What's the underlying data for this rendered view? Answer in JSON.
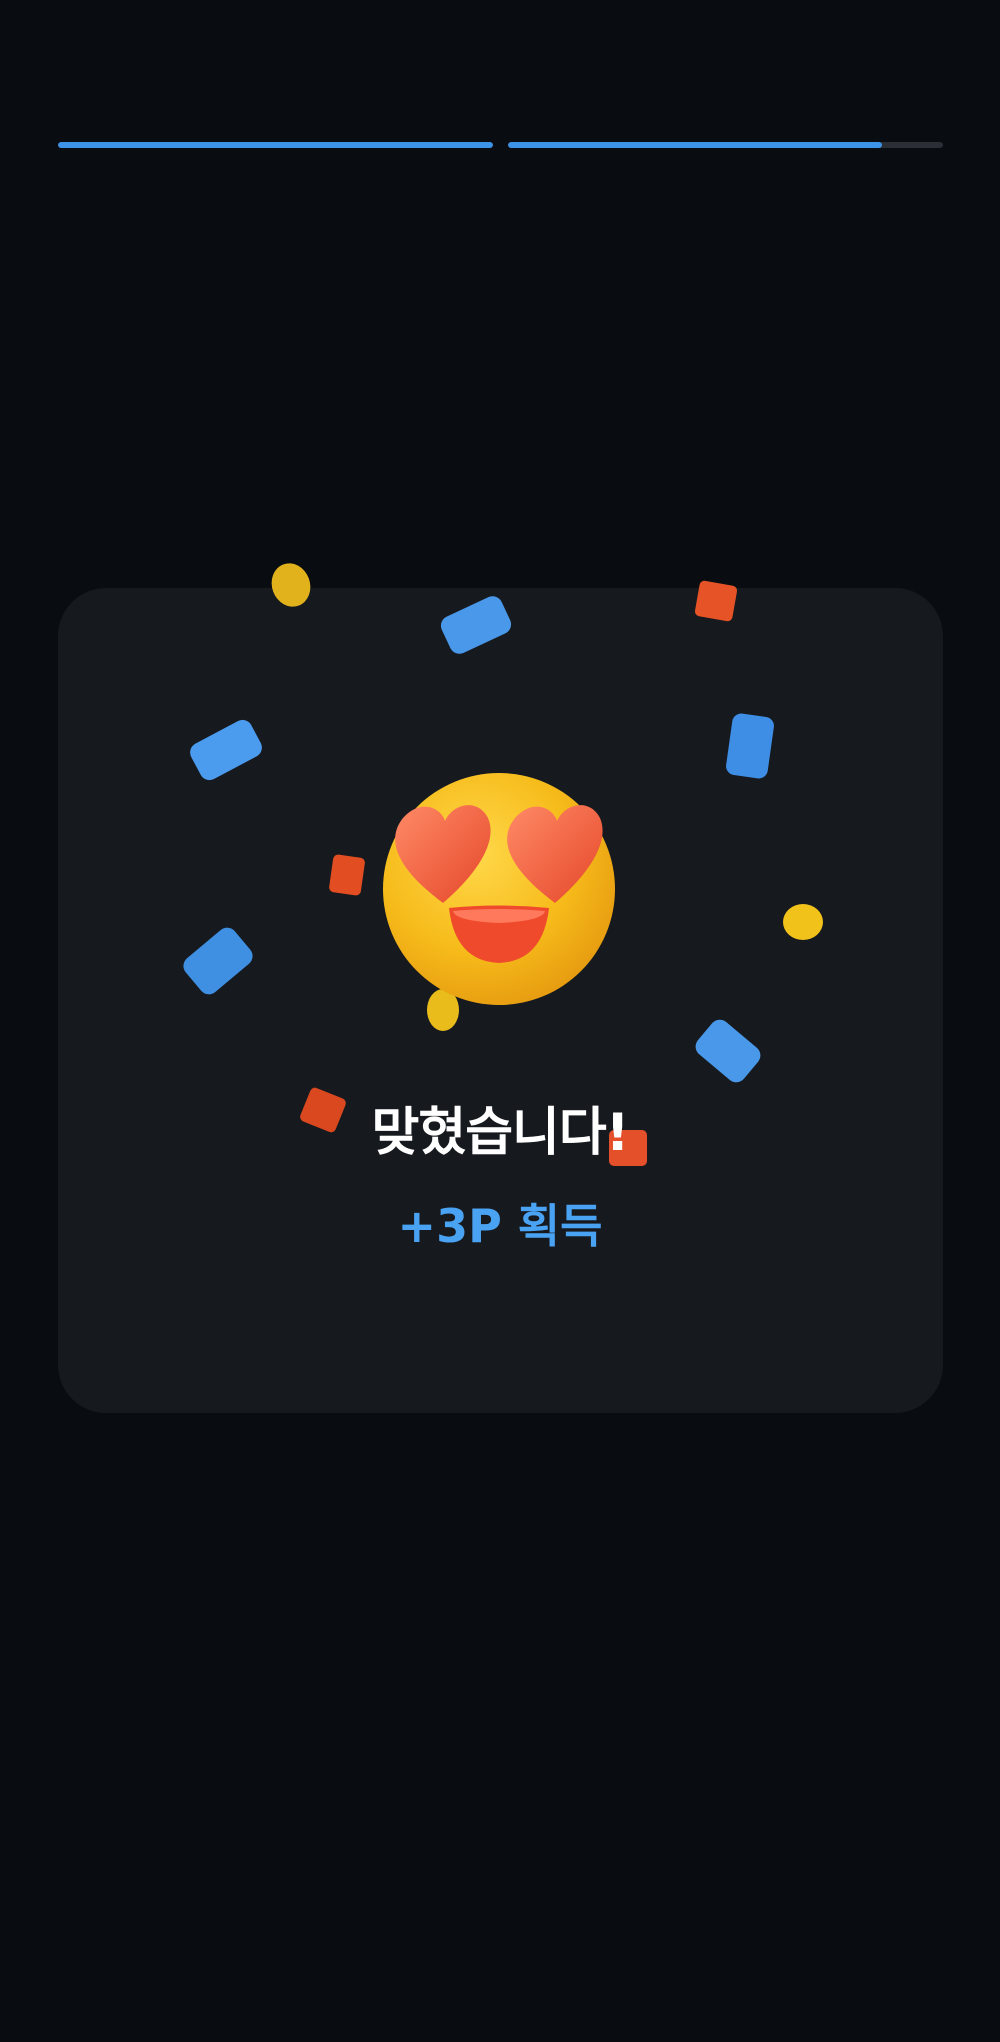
{
  "progress": {
    "segments": [
      {
        "fill": 1.0
      },
      {
        "fill": 0.86
      }
    ],
    "fill_color": "#3d93e8",
    "track_color": "#2b2f35"
  },
  "result": {
    "title": "맞혔습니다!",
    "reward": "+3P 획득",
    "emoji": "heart-eyes-smiley"
  },
  "colors": {
    "background": "#090c10",
    "card": "#16191e",
    "reward_text": "#4aa2f2"
  }
}
